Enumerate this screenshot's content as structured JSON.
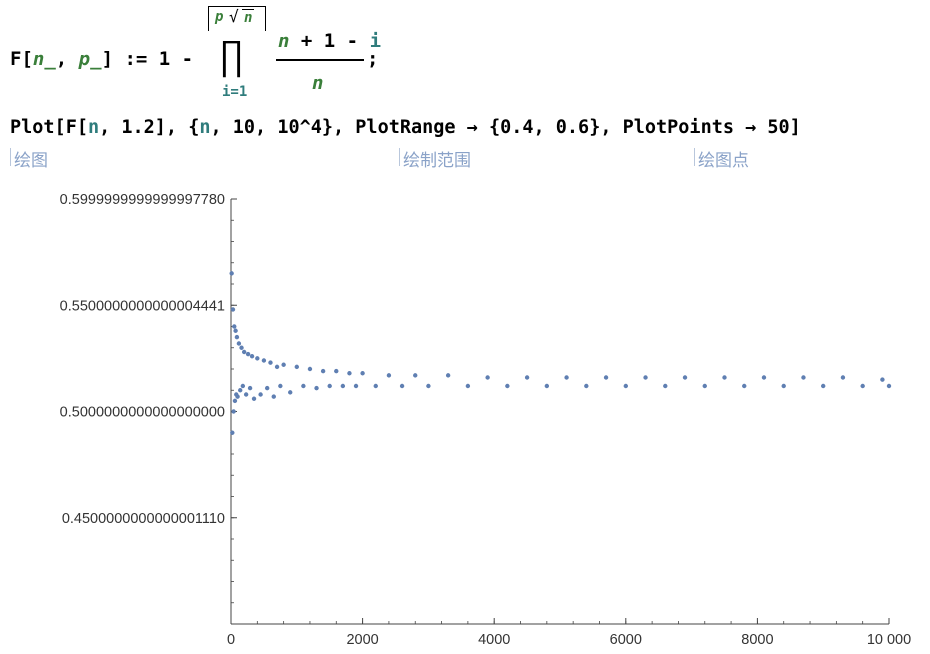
{
  "def": {
    "lhs_head": "F[",
    "lhs_n": "n_",
    "lhs_sep": ", ",
    "lhs_p": "p_",
    "lhs_close": "] := 1 -",
    "upper_p": "p",
    "upper_sqrt": "√",
    "upper_n": "n",
    "prod": "∏",
    "lower": "i=1",
    "num_n": "n",
    "num_rest": "+ 1 -",
    "num_i": "i",
    "den": "n",
    "semicolon": ";"
  },
  "plot_cmd": {
    "pre": "Plot[F[",
    "n1": "n",
    "mid": ", 1.2], {",
    "n2": "n",
    "post": ", 10, 10^4}, PlotRange → {0.4, 0.6}, PlotPoints → 50]"
  },
  "hints": [
    "绘图",
    "绘制范围",
    "绘图点"
  ],
  "colors": {
    "points": "#5f7fb2",
    "axis": "#444444",
    "hint": "#8aa2c8",
    "green": "#3a7f3a",
    "teal": "#2f7c7c"
  },
  "chart_data": {
    "type": "scatter",
    "xlim": [
      0,
      10000
    ],
    "ylim": [
      0.4,
      0.6
    ],
    "y_ticks": [
      {
        "value": 0.6,
        "label": "0.5999999999999997780"
      },
      {
        "value": 0.55,
        "label": "0.5500000000000004441"
      },
      {
        "value": 0.5,
        "label": "0.5000000000000000000"
      },
      {
        "value": 0.45,
        "label": "0.4500000000000001110"
      }
    ],
    "x_ticks": [
      {
        "value": 0,
        "label": "0"
      },
      {
        "value": 2000,
        "label": "2000"
      },
      {
        "value": 4000,
        "label": "4000"
      },
      {
        "value": 6000,
        "label": "6000"
      },
      {
        "value": 8000,
        "label": "8000"
      },
      {
        "value": 10000,
        "label": "10 000"
      }
    ],
    "series": [
      {
        "x": [
          10,
          20,
          30,
          40,
          50,
          60,
          70,
          80,
          90,
          100,
          120,
          140,
          160,
          180,
          200,
          230,
          260,
          290,
          320,
          350,
          400,
          450,
          500,
          550,
          600,
          650,
          700,
          750,
          800,
          900,
          1000,
          1100,
          1200,
          1300,
          1400,
          1500,
          1600,
          1700,
          1800,
          1900,
          2000,
          2200,
          2400,
          2600,
          2800,
          3000,
          3300,
          3600,
          3900,
          4200,
          4500,
          4800,
          5100,
          5400,
          5700,
          6000,
          6300,
          6600,
          6900,
          7200,
          7500,
          7800,
          8100,
          8400,
          8700,
          9000,
          9300,
          9600,
          9900,
          10000
        ],
        "y": [
          0.565,
          0.49,
          0.548,
          0.5,
          0.54,
          0.505,
          0.538,
          0.508,
          0.535,
          0.507,
          0.532,
          0.51,
          0.53,
          0.512,
          0.528,
          0.508,
          0.527,
          0.511,
          0.526,
          0.506,
          0.525,
          0.508,
          0.524,
          0.511,
          0.523,
          0.507,
          0.521,
          0.512,
          0.522,
          0.509,
          0.521,
          0.512,
          0.52,
          0.511,
          0.519,
          0.512,
          0.519,
          0.512,
          0.518,
          0.512,
          0.518,
          0.512,
          0.517,
          0.512,
          0.517,
          0.512,
          0.517,
          0.512,
          0.516,
          0.512,
          0.516,
          0.512,
          0.516,
          0.512,
          0.516,
          0.512,
          0.516,
          0.512,
          0.516,
          0.512,
          0.516,
          0.512,
          0.516,
          0.512,
          0.516,
          0.512,
          0.516,
          0.512,
          0.515,
          0.512
        ]
      }
    ]
  }
}
